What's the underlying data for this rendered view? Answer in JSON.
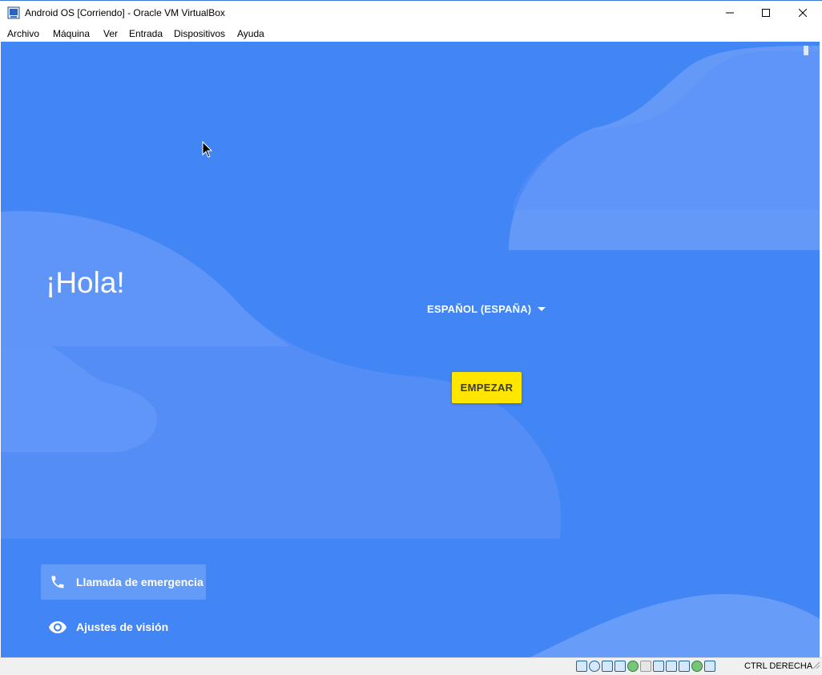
{
  "window": {
    "title": "Android OS [Corriendo] - Oracle VM VirtualBox",
    "app_icon": "virtualbox-icon",
    "controls": [
      "minimize-icon",
      "maximize-icon",
      "close-icon"
    ]
  },
  "menubar": {
    "items": [
      "Archivo",
      "Máquina",
      "Ver",
      "Entrada",
      "Dispositivos",
      "Ayuda"
    ]
  },
  "guest": {
    "background_color": "#4285f4",
    "greeting": "¡Hola!",
    "language_selector": {
      "label": "ESPAÑOL (ESPAÑA)",
      "icon": "caret-down-icon"
    },
    "start_button": {
      "label": "EMPEZAR",
      "color": "#ffe600"
    },
    "emergency_call": {
      "label": "Llamada de emergencia",
      "icon": "phone-icon"
    },
    "vision_settings": {
      "label": "Ajustes de visión",
      "icon": "eye-icon"
    }
  },
  "statusbar": {
    "icons": [
      "hard-disk-icon",
      "optical-drive-icon",
      "audio-icon",
      "network-icon",
      "usb-icon",
      "shared-folders-icon",
      "display-icon",
      "video-capture-icon",
      "cpu-icon",
      "mouse-integration-icon",
      "arrow-down-icon"
    ],
    "host_key": "CTRL DERECHA"
  }
}
